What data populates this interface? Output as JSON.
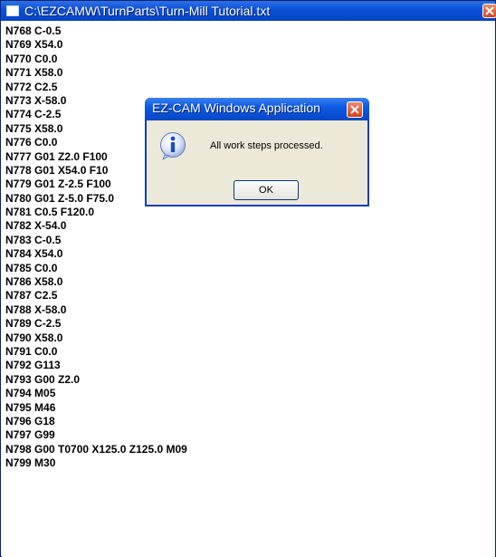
{
  "window": {
    "title": "C:\\EZCAMW\\TurnParts\\Turn-Mill Tutorial.txt",
    "icon": "notepad-icon",
    "close_icon": "close-icon",
    "close_color": "#d2401b"
  },
  "code_lines": [
    "N768 C-0.5",
    "N769 X54.0",
    "N770 C0.0",
    "N771 X58.0",
    "N772 C2.5",
    "N773 X-58.0",
    "N774 C-2.5",
    "N775 X58.0",
    "N776 C0.0",
    "N777 G01 Z2.0 F100",
    "N778 G01 X54.0 F10",
    "N779 G01 Z-2.5 F100",
    "N780 G01 Z-5.0 F75.0",
    "N781 C0.5 F120.0",
    "N782 X-54.0",
    "N783 C-0.5",
    "N784 X54.0",
    "N785 C0.0",
    "N786 X58.0",
    "N787 C2.5",
    "N788 X-58.0",
    "N789 C-2.5",
    "N790 X58.0",
    "N791 C0.0",
    "N792 G113",
    "N793 G00 Z2.0",
    "N794 M05",
    "N795 M46",
    "N796 G18",
    "N797 G99",
    "N798 G00 T0700 X125.0 Z125.0 M09",
    "N799 M30"
  ],
  "dialog": {
    "title": "EZ-CAM Windows Application",
    "message": "All work steps processed.",
    "ok_label": "OK",
    "icon": "info-icon",
    "accent": "#0a50d8"
  }
}
